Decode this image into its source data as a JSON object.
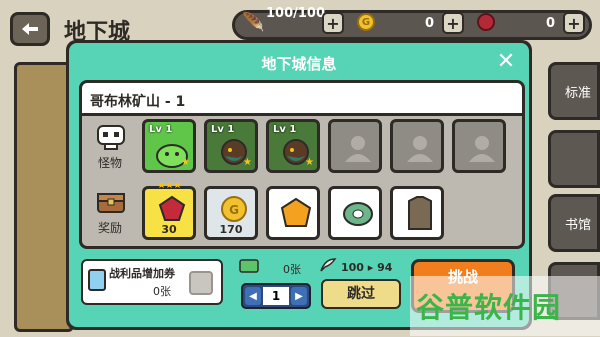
{
  "top": {
    "title": "地下城",
    "stamina": "100/100",
    "gold": "0",
    "gems": "0",
    "plus": "+"
  },
  "right_tabs": [
    "标准",
    "",
    "书馆",
    ""
  ],
  "modal": {
    "title": "地下城信息",
    "close": "✕",
    "dungeon_name": "哥布林矿山 - 1",
    "monster_label": "怪物",
    "reward_label": "奖励",
    "monsters": [
      {
        "level": "Lv 1",
        "type": "green-slime"
      },
      {
        "level": "Lv 1",
        "type": "goblin"
      },
      {
        "level": "Lv 1",
        "type": "goblin"
      }
    ],
    "rewards": [
      {
        "item": "ruby",
        "qty": "30",
        "stars": "★★★"
      },
      {
        "item": "gold-coin",
        "qty": "170"
      },
      {
        "item": "amber-gem",
        "qty": ""
      },
      {
        "item": "thread-spool",
        "qty": ""
      },
      {
        "item": "leather-armor",
        "qty": ""
      }
    ],
    "voucher_label": "战利品增加券",
    "voucher_count": "0张",
    "ticket_cost": "0张",
    "stamina_cost": "100 ▸ 94",
    "stepper_value": "1",
    "skip": "跳过",
    "challenge": "挑战"
  },
  "watermark": "谷普软件园",
  "colors": {
    "modal_bg": "#57d3b6",
    "challenge": "#f07d1e",
    "skip": "#eedc8a"
  }
}
